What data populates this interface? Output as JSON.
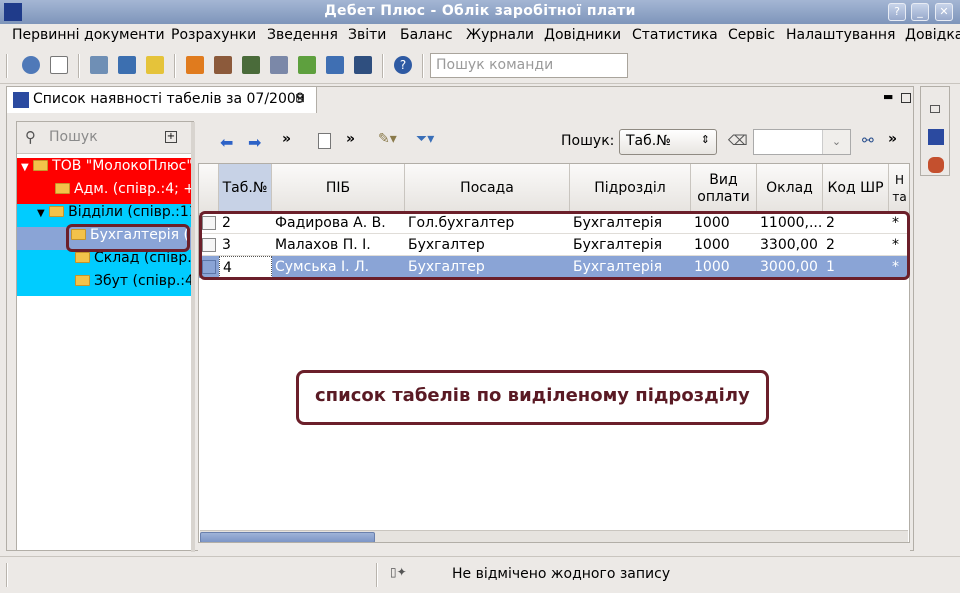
{
  "window": {
    "title": "Дебет Плюс - Облік заробітної плати"
  },
  "menu": [
    "Первинні документи",
    "Розрахунки",
    "Зведення",
    "Звіти",
    "Баланс",
    "Журнали",
    "Довідники",
    "Статистика",
    "Сервіс",
    "Налаштування",
    "Довідка"
  ],
  "command_search": {
    "placeholder": "Пошук команди"
  },
  "view": {
    "tab_title": "Список наявності табелів за 07/2009"
  },
  "tree": {
    "search_placeholder": "Пошук",
    "items": [
      {
        "label": "ТОВ \"МолокоПлюс\" (спів"
      },
      {
        "label": "Адм. (співр.:4; +0"
      },
      {
        "label": "Відділи (співр.:11"
      },
      {
        "label": "Бухгалтерія ("
      },
      {
        "label": "Склад (співр.:4"
      },
      {
        "label": "Збут (співр.:4;"
      }
    ]
  },
  "grid": {
    "search_label": "Пошук:",
    "search_field": "Таб.№",
    "columns": [
      "Таб.№",
      "ПІБ",
      "Посада",
      "Підрозділ",
      "Вид оплати",
      "Оклад",
      "Код ШР",
      "Н та"
    ],
    "rows": [
      {
        "tab": "2",
        "name": "Фадирова А. В.",
        "position": "Гол.бухгалтер",
        "dept": "Бухгалтерія",
        "pay": "1000",
        "salary": "11000,...",
        "code": "2",
        "extra": "*"
      },
      {
        "tab": "3",
        "name": "Малахов П. І.",
        "position": "Бухгалтер",
        "dept": "Бухгалтерія",
        "pay": "1000",
        "salary": "3300,00",
        "code": "2",
        "extra": "*"
      },
      {
        "tab": "4",
        "name": "Сумська І. Л.",
        "position": "Бухгалтер",
        "dept": "Бухгалтерія",
        "pay": "1000",
        "salary": "3000,00",
        "code": "1",
        "extra": "*"
      }
    ]
  },
  "annotation": {
    "text": "список табелів по виділеному підрозділу"
  },
  "status": {
    "text": "Не відмічено жодного запису"
  },
  "colors": {
    "tree_red": "#ff0000",
    "tree_cyan": "#00ccff",
    "selection": "#8aa4d6",
    "callout_border": "#6b1f2a"
  }
}
